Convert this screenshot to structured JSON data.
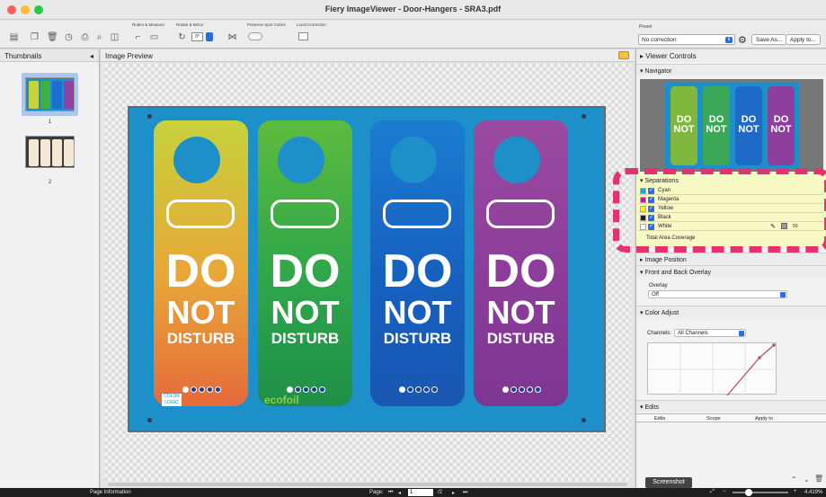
{
  "window": {
    "title": "Fiery ImageViewer - Door-Hangers - SRA3.pdf"
  },
  "toolbar": {
    "groups": [
      "Rulers & Measure",
      "Rotate & Mirror",
      "Preserve Spot Colors",
      "Local Correction"
    ],
    "rotate_value": "0°",
    "preset_label": "Preset",
    "preset_value": "No correction",
    "save_as": "Save As...",
    "apply_to": "Apply to..."
  },
  "thumbnails": {
    "title": "Thumbnails",
    "pages": [
      "1",
      "2"
    ]
  },
  "preview": {
    "title": "Image Preview",
    "hanger_words": [
      "DO",
      "NOT",
      "DISTURB"
    ],
    "hanger_colors": [
      [
        "#c7d23c",
        "#e8a637",
        "#e56a3c"
      ],
      [
        "#5dbb3f",
        "#2fa64a",
        "#1f8f48"
      ],
      [
        "#1b7dd0",
        "#1660bf",
        "#1a57b3"
      ],
      [
        "#9a4aa0",
        "#8c3d9a",
        "#7e3592"
      ]
    ],
    "brand_logo": "ecofoil"
  },
  "viewer": {
    "title": "Viewer Controls",
    "navigator": "Navigator",
    "separations_title": "Separations",
    "separations": [
      {
        "name": "Cyan",
        "color": "#00aeef"
      },
      {
        "name": "Magenta",
        "color": "#ec008c"
      },
      {
        "name": "Yellow",
        "color": "#fff200"
      },
      {
        "name": "Black",
        "color": "#231f20"
      },
      {
        "name": "White",
        "color": "#ffffff"
      }
    ],
    "white_value": "50",
    "total_coverage": "Total Area Coverage",
    "image_position": "Image Position",
    "front_back": "Front and Back Overlay",
    "overlay_label": "Overlay",
    "overlay_value": "Off",
    "color_adjust": "Color Adjust",
    "channels_label": "Channels:",
    "channels_value": "All Channels",
    "edits_title": "Edits",
    "edits_columns": [
      "Edits",
      "Scope",
      "Apply to"
    ]
  },
  "status": {
    "page_info": "Page Information",
    "page_label": "Page:",
    "page_current": "1",
    "page_total": "/2",
    "screenshot": "Screenshot",
    "zoom": "4.419%"
  }
}
